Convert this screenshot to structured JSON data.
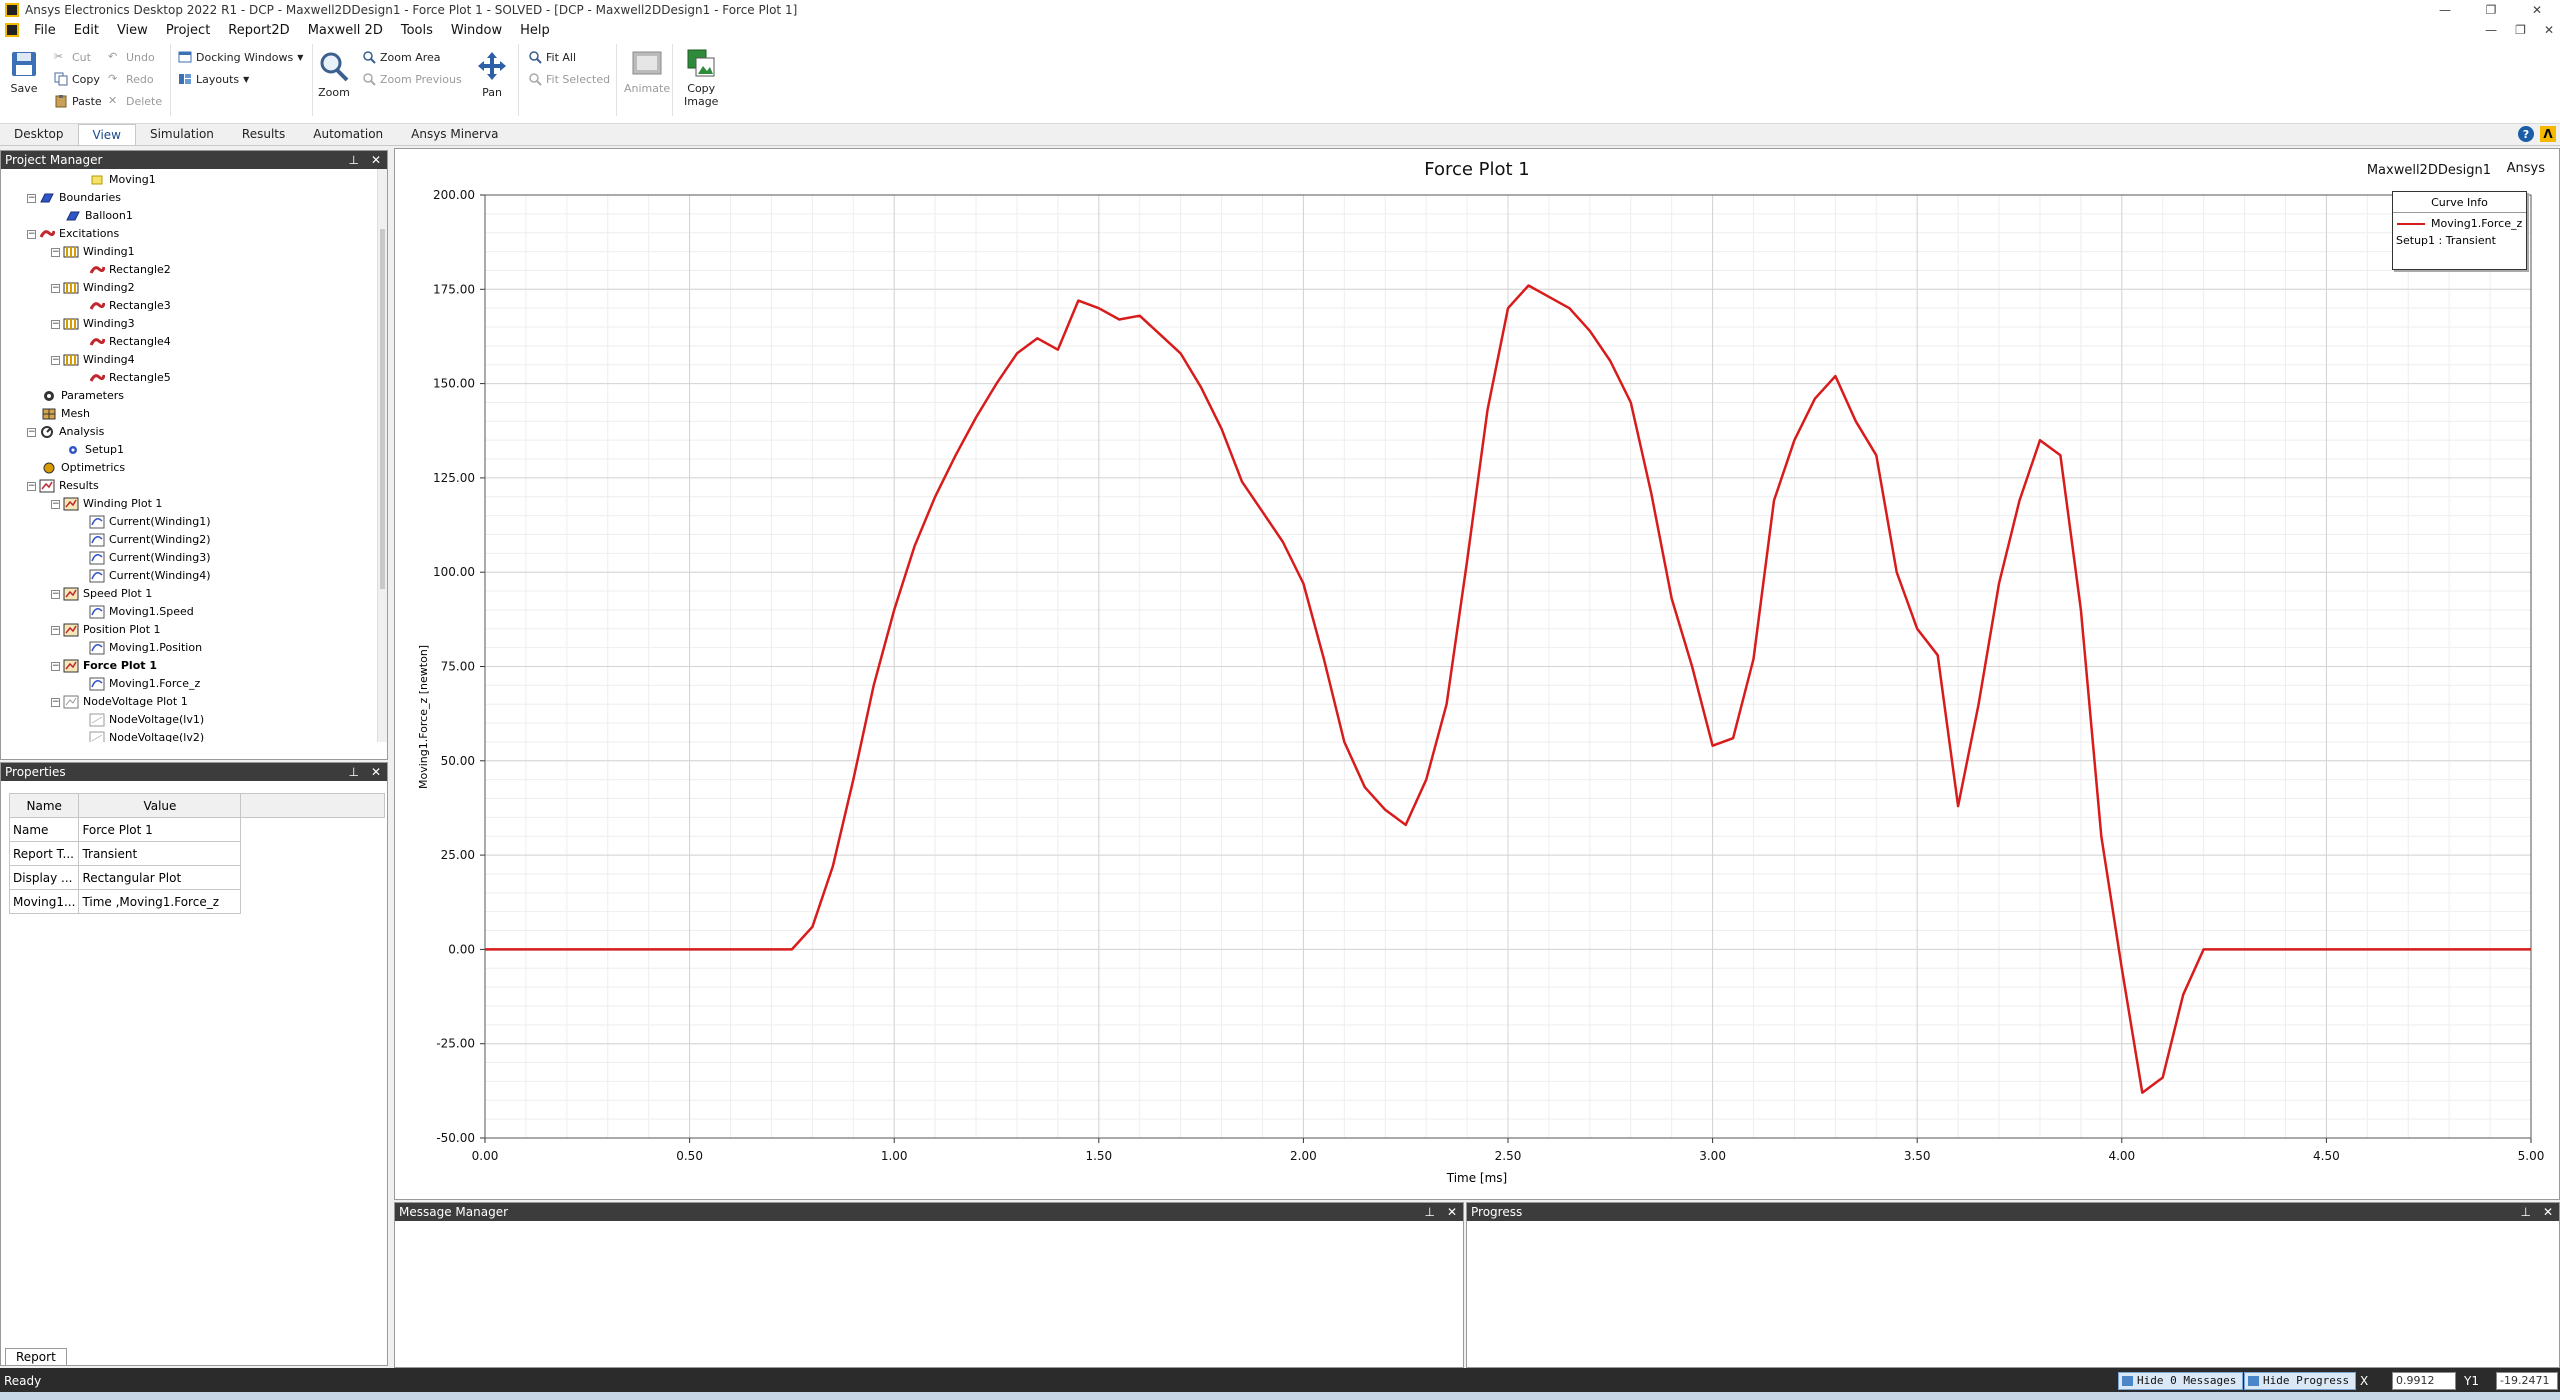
{
  "window": {
    "title": "Ansys Electronics Desktop 2022 R1 - DCP - Maxwell2DDesign1 - Force Plot 1 - SOLVED - [DCP - Maxwell2DDesign1 - Force Plot 1]",
    "minimize": "—",
    "restore": "❐",
    "close": "✕"
  },
  "menu": {
    "items": [
      "File",
      "Edit",
      "View",
      "Project",
      "Report2D",
      "Maxwell 2D",
      "Tools",
      "Window",
      "Help"
    ],
    "mdi_min": "—",
    "mdi_restore": "❐",
    "mdi_close": "✕"
  },
  "ribbon": {
    "save": "Save",
    "cut": "Cut",
    "copy": "Copy",
    "paste": "Paste",
    "undo": "Undo",
    "redo": "Redo",
    "delete": "Delete",
    "docking_windows": "Docking Windows",
    "layouts": "Layouts",
    "zoom": "Zoom",
    "zoom_area": "Zoom Area",
    "zoom_previous": "Zoom Previous",
    "pan": "Pan",
    "fit_all": "Fit All",
    "fit_selected": "Fit Selected",
    "animate": "Animate",
    "copy_image_line1": "Copy",
    "copy_image_line2": "Image"
  },
  "tabs": [
    "Desktop",
    "View",
    "Simulation",
    "Results",
    "Automation",
    "Ansys Minerva"
  ],
  "project_manager": {
    "title": "Project Manager",
    "rows": [
      {
        "label": "Moving1",
        "level": 3,
        "icon": "moving",
        "toggle": ""
      },
      {
        "label": "Boundaries",
        "level": 1,
        "icon": "boundaries",
        "toggle": "−"
      },
      {
        "label": "Balloon1",
        "level": 2,
        "icon": "balloon",
        "toggle": ""
      },
      {
        "label": "Excitations",
        "level": 1,
        "icon": "excitations",
        "toggle": "−"
      },
      {
        "label": "Winding1",
        "level": 2,
        "icon": "winding",
        "toggle": "−"
      },
      {
        "label": "Rectangle2",
        "level": 3,
        "icon": "coil",
        "toggle": ""
      },
      {
        "label": "Winding2",
        "level": 2,
        "icon": "winding",
        "toggle": "−"
      },
      {
        "label": "Rectangle3",
        "level": 3,
        "icon": "coil",
        "toggle": ""
      },
      {
        "label": "Winding3",
        "level": 2,
        "icon": "winding",
        "toggle": "−"
      },
      {
        "label": "Rectangle4",
        "level": 3,
        "icon": "coil",
        "toggle": ""
      },
      {
        "label": "Winding4",
        "level": 2,
        "icon": "winding",
        "toggle": "−"
      },
      {
        "label": "Rectangle5",
        "level": 3,
        "icon": "coil",
        "toggle": ""
      },
      {
        "label": "Parameters",
        "level": 1,
        "icon": "parameters",
        "toggle": ""
      },
      {
        "label": "Mesh",
        "level": 1,
        "icon": "mesh",
        "toggle": ""
      },
      {
        "label": "Analysis",
        "level": 1,
        "icon": "analysis",
        "toggle": "−"
      },
      {
        "label": "Setup1",
        "level": 2,
        "icon": "setup",
        "toggle": ""
      },
      {
        "label": "Optimetrics",
        "level": 1,
        "icon": "optimetrics",
        "toggle": ""
      },
      {
        "label": "Results",
        "level": 1,
        "icon": "results",
        "toggle": "−"
      },
      {
        "label": "Winding Plot 1",
        "level": 2,
        "icon": "plot",
        "toggle": "−"
      },
      {
        "label": "Current(Winding1)",
        "level": 3,
        "icon": "trace",
        "toggle": ""
      },
      {
        "label": "Current(Winding2)",
        "level": 3,
        "icon": "trace",
        "toggle": ""
      },
      {
        "label": "Current(Winding3)",
        "level": 3,
        "icon": "trace",
        "toggle": ""
      },
      {
        "label": "Current(Winding4)",
        "level": 3,
        "icon": "trace",
        "toggle": ""
      },
      {
        "label": "Speed Plot 1",
        "level": 2,
        "icon": "plot",
        "toggle": "−"
      },
      {
        "label": "Moving1.Speed",
        "level": 3,
        "icon": "trace",
        "toggle": ""
      },
      {
        "label": "Position Plot 1",
        "level": 2,
        "icon": "plot",
        "toggle": "−"
      },
      {
        "label": "Moving1.Position",
        "level": 3,
        "icon": "trace",
        "toggle": ""
      },
      {
        "label": "Force Plot 1",
        "level": 2,
        "icon": "plot",
        "toggle": "−",
        "bold": true
      },
      {
        "label": "Moving1.Force_z",
        "level": 3,
        "icon": "trace",
        "toggle": ""
      },
      {
        "label": "NodeVoltage Plot 1",
        "level": 2,
        "icon": "plot-empty",
        "toggle": "−"
      },
      {
        "label": "NodeVoltage(lv1)",
        "level": 3,
        "icon": "trace-empty",
        "toggle": ""
      },
      {
        "label": "NodeVoltage(lv2)",
        "level": 3,
        "icon": "trace-empty",
        "toggle": ""
      }
    ]
  },
  "properties": {
    "title": "Properties",
    "headers": [
      "Name",
      "Value"
    ],
    "rows": [
      [
        "Name",
        "Force Plot 1"
      ],
      [
        "Report T...",
        "Transient"
      ],
      [
        "Display ...",
        "Rectangular Plot"
      ],
      [
        "Moving1...",
        "Time ,Moving1.Force_z"
      ]
    ],
    "tab": "Report"
  },
  "plot": {
    "design": "Maxwell2DDesign1",
    "brand": "Ansys",
    "legend_title": "Curve Info",
    "legend_sub": "Setup1 : Transient"
  },
  "chart_data": {
    "type": "line",
    "title": "Force Plot 1",
    "xlabel": "Time [ms]",
    "ylabel": "Moving1.Force_z [newton]",
    "xlim": [
      0,
      5
    ],
    "ylim": [
      -50,
      200
    ],
    "xticks": [
      "0.00",
      "0.50",
      "1.00",
      "1.50",
      "2.00",
      "2.50",
      "3.00",
      "3.50",
      "4.00",
      "4.50",
      "5.00"
    ],
    "yticks": [
      "200.00",
      "175.00",
      "150.00",
      "125.00",
      "100.00",
      "75.00",
      "50.00",
      "25.00",
      "0.00",
      "-25.00",
      "-50.00"
    ],
    "grid": true,
    "legend": "top-right",
    "series": [
      {
        "name": "Moving1.Force_z",
        "color": "#d81b1b",
        "points": [
          [
            0.0,
            0
          ],
          [
            0.75,
            0
          ],
          [
            0.8,
            6
          ],
          [
            0.85,
            22
          ],
          [
            0.9,
            45
          ],
          [
            0.95,
            70
          ],
          [
            1.0,
            90
          ],
          [
            1.05,
            107
          ],
          [
            1.1,
            120
          ],
          [
            1.15,
            131
          ],
          [
            1.2,
            141
          ],
          [
            1.25,
            150
          ],
          [
            1.3,
            158
          ],
          [
            1.35,
            162
          ],
          [
            1.4,
            159
          ],
          [
            1.45,
            172
          ],
          [
            1.5,
            170
          ],
          [
            1.55,
            167
          ],
          [
            1.6,
            168
          ],
          [
            1.65,
            163
          ],
          [
            1.7,
            158
          ],
          [
            1.75,
            149
          ],
          [
            1.8,
            138
          ],
          [
            1.85,
            124
          ],
          [
            1.9,
            116
          ],
          [
            1.95,
            108
          ],
          [
            2.0,
            97
          ],
          [
            2.05,
            77
          ],
          [
            2.1,
            55
          ],
          [
            2.15,
            43
          ],
          [
            2.2,
            37
          ],
          [
            2.25,
            33
          ],
          [
            2.3,
            45
          ],
          [
            2.35,
            65
          ],
          [
            2.4,
            103
          ],
          [
            2.45,
            143
          ],
          [
            2.5,
            170
          ],
          [
            2.55,
            176
          ],
          [
            2.6,
            173
          ],
          [
            2.65,
            170
          ],
          [
            2.7,
            164
          ],
          [
            2.75,
            156
          ],
          [
            2.8,
            145
          ],
          [
            2.85,
            121
          ],
          [
            2.9,
            93
          ],
          [
            2.95,
            75
          ],
          [
            3.0,
            54
          ],
          [
            3.05,
            56
          ],
          [
            3.1,
            77
          ],
          [
            3.15,
            119
          ],
          [
            3.2,
            135
          ],
          [
            3.25,
            146
          ],
          [
            3.3,
            152
          ],
          [
            3.35,
            140
          ],
          [
            3.4,
            131
          ],
          [
            3.45,
            100
          ],
          [
            3.5,
            85
          ],
          [
            3.55,
            78
          ],
          [
            3.6,
            38
          ],
          [
            3.65,
            65
          ],
          [
            3.7,
            97
          ],
          [
            3.75,
            119
          ],
          [
            3.8,
            135
          ],
          [
            3.85,
            131
          ],
          [
            3.9,
            90
          ],
          [
            3.95,
            30
          ],
          [
            4.0,
            -5
          ],
          [
            4.05,
            -38
          ],
          [
            4.1,
            -34
          ],
          [
            4.15,
            -12
          ],
          [
            4.2,
            0
          ],
          [
            5.0,
            0
          ]
        ]
      }
    ]
  },
  "message_manager": {
    "title": "Message Manager"
  },
  "progress": {
    "title": "Progress"
  },
  "status": {
    "text": "Ready",
    "hide_messages": "Hide 0 Messages",
    "hide_progress": "Hide Progress",
    "x_label": "X",
    "x_value": "0.9912",
    "y_label": "Y1",
    "y_value": "-19.2471"
  }
}
